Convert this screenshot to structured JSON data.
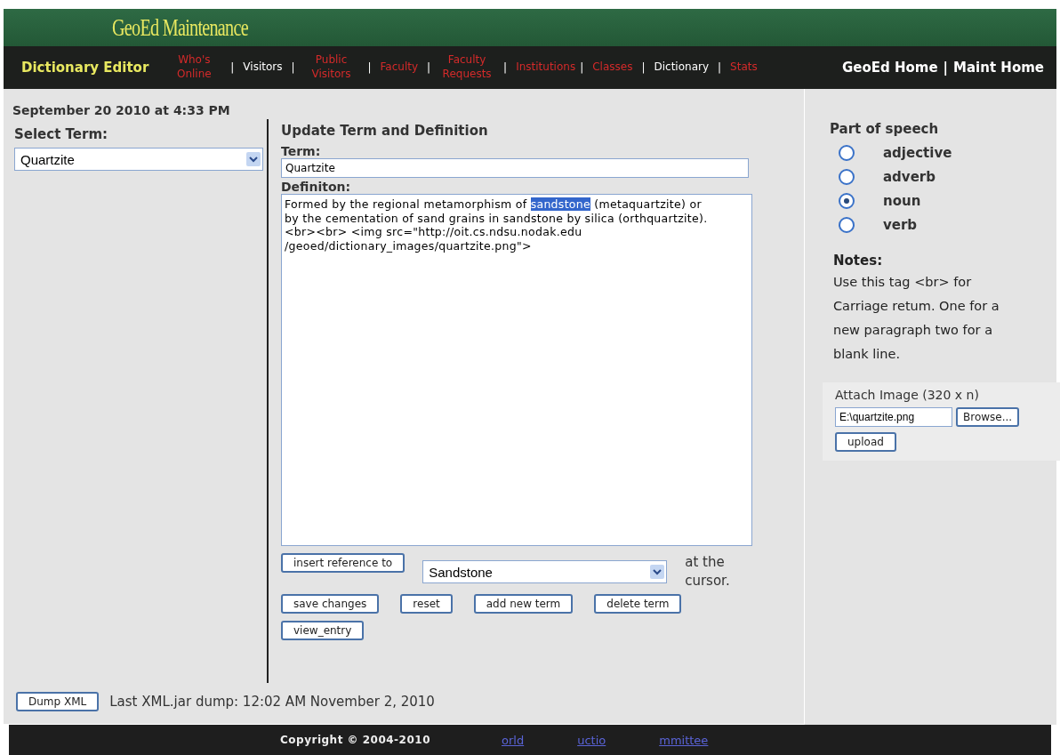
{
  "header": {
    "title": "GeoEd Maintenance"
  },
  "nav": {
    "page_title": "Dictionary Editor",
    "items": [
      {
        "kind": "link",
        "label": "Who's Online",
        "color": "#d42a2a"
      },
      {
        "kind": "separator",
        "label": "|"
      },
      {
        "kind": "link",
        "label": "Visitors",
        "color": "#ffffff"
      },
      {
        "kind": "separator",
        "label": "|"
      },
      {
        "kind": "link",
        "label": "Public Visitors",
        "color": "#d42a2a"
      },
      {
        "kind": "separator",
        "label": "|"
      },
      {
        "kind": "link",
        "label": "Faculty",
        "color": "#d42a2a"
      },
      {
        "kind": "separator",
        "label": "|"
      },
      {
        "kind": "link",
        "label": "Faculty Requests",
        "color": "#d42a2a"
      },
      {
        "kind": "separator",
        "label": "|"
      },
      {
        "kind": "link",
        "label": "Institutions",
        "color": "#d42a2a"
      },
      {
        "kind": "separator",
        "label": "|"
      },
      {
        "kind": "link",
        "label": "Classes",
        "color": "#d42a2a"
      },
      {
        "kind": "separator",
        "label": "|"
      },
      {
        "kind": "link",
        "label": "Dictionary",
        "color": "#ffffff"
      },
      {
        "kind": "separator",
        "label": "|"
      },
      {
        "kind": "link",
        "label": "Stats",
        "color": "#d42a2a"
      }
    ],
    "home_links": [
      "GeoEd Home",
      "|",
      "Maint Home"
    ]
  },
  "timestamp": "September 20 2010 at 4:33 PM",
  "select_term": {
    "label": "Select Term:",
    "value": "Quartzite"
  },
  "update": {
    "heading": "Update Term and Definition",
    "term_label": "Term:",
    "term_value": "Quartzite",
    "definition_label": "Definiton:",
    "definition": {
      "before": "Formed by the regional metamorphism of ",
      "selection": "sandstone",
      "after": " (metaquartzite) or by the cementation of sand grains in sandstone by silica (orthquartzite). <br><br> <img src=\"http://oit.cs.ndsu.nodak.edu /geoed/dictionary_images/quartzite.png\">"
    },
    "insert_button": "insert reference to",
    "reference_value": "Sandstone",
    "insert_suffix": "at the cursor.",
    "buttons": [
      "save changes",
      "reset",
      "add new term",
      "delete term",
      "view_entry"
    ]
  },
  "part_of_speech": {
    "label": "Part of speech",
    "options": [
      {
        "label": "adjective",
        "selected": false
      },
      {
        "label": "adverb",
        "selected": false
      },
      {
        "label": "noun",
        "selected": true
      },
      {
        "label": "verb",
        "selected": false
      }
    ]
  },
  "notes": {
    "label": "Notes:",
    "text": "Use this tag <br> for Carriage retum. One for a new paragraph two for a blank line."
  },
  "attach": {
    "label": "Attach Image (320 x n)",
    "file_value": "E:\\quartzite.png",
    "browse_button": "Browse...",
    "upload_button": "upload"
  },
  "dump": {
    "button": "Dump XML",
    "text": "Last XML.jar dump: 12:02 AM November 2, 2010"
  },
  "footer": {
    "copyright": "Copyright © 2004-2010",
    "fragments": [
      "orld",
      "uctio",
      "mmittee"
    ]
  }
}
